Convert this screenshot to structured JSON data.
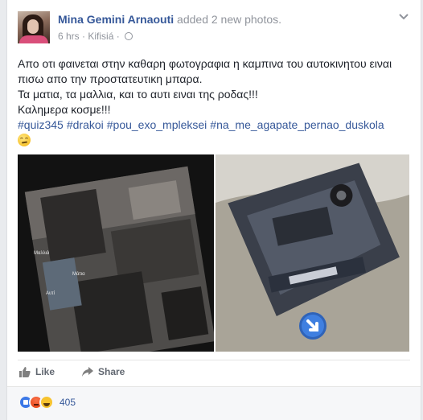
{
  "post": {
    "author": "Mina Gemini Arnaouti",
    "action": " added 2 new photos.",
    "time": "6 hrs",
    "separator": " · ",
    "location": "Kifisiá",
    "dot": " · ",
    "text_lines": [
      "Απο οτι φαινεται στην καθαρη φωτογραφια η καμπινα του αυτοκινητου ειναι",
      "πισω απο την προστατευτικη μπαρα.",
      "Τα ματια, τα μαλλια, και το αυτι ειναι της ροδας!!!",
      "Καλημερα κοσμε!!!"
    ],
    "hashtags": [
      "#quiz345",
      "#drakoi",
      "#pou_exo_mpleksei",
      "#na_me_agapate_pernao_duskola"
    ],
    "emoji_icon": "rolling-eyes-emoji-icon"
  },
  "photos": {
    "photo1_labels": [
      "Μαλλιά",
      "Μάτια",
      "Αυτί"
    ]
  },
  "actions": {
    "like_label": "Like",
    "share_label": "Share"
  },
  "reactions": {
    "icons": [
      "like-reaction-icon",
      "angry-reaction-icon",
      "haha-reaction-icon"
    ],
    "count": "405"
  },
  "colors": {
    "link": "#365899",
    "meta": "#90949c",
    "background": "#e9ebee"
  }
}
